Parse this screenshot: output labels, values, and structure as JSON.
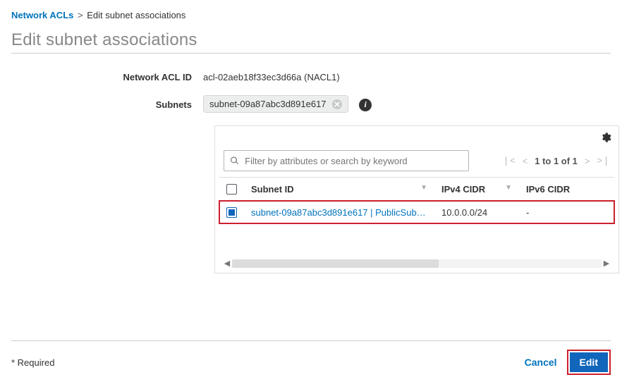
{
  "breadcrumb": {
    "root": "Network ACLs",
    "current": "Edit subnet associations"
  },
  "title": "Edit subnet associations",
  "form": {
    "acl_label": "Network ACL ID",
    "acl_value": "acl-02aeb18f33ec3d66a (NACL1)",
    "subnets_label": "Subnets",
    "subnet_chip": "subnet-09a87abc3d891e617"
  },
  "search": {
    "placeholder": "Filter by attributes or search by keyword"
  },
  "pager": {
    "text": "1 to 1 of 1"
  },
  "columns": {
    "subnet": "Subnet ID",
    "ipv4": "IPv4 CIDR",
    "ipv6": "IPv6 CIDR"
  },
  "rows": [
    {
      "subnet": "subnet-09a87abc3d891e617 | PublicSub…",
      "ipv4": "10.0.0.0/24",
      "ipv6": "-",
      "checked": true
    }
  ],
  "footer": {
    "required": "* Required",
    "cancel": "Cancel",
    "edit": "Edit"
  }
}
